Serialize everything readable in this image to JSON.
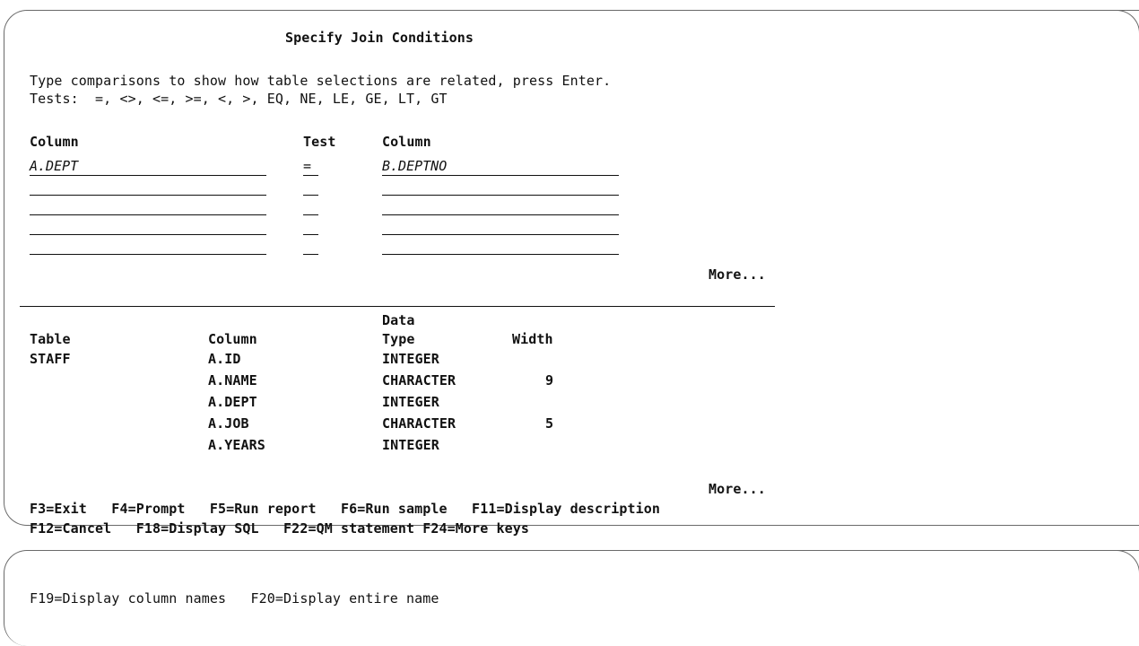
{
  "title": "Specify Join Conditions",
  "instructions": {
    "line1": "Type comparisons to show how table selections are related, press Enter.",
    "line2": "Tests:  =, <>, <=, >=, <, >, EQ, NE, LE, GE, LT, GT"
  },
  "join": {
    "headers": {
      "left_column": "Column",
      "test": "Test",
      "right_column": "Column"
    },
    "rows": [
      {
        "left": "A.DEPT",
        "test": "=",
        "right": "B.DEPTNO"
      },
      {
        "left": "",
        "test": "",
        "right": ""
      },
      {
        "left": "",
        "test": "",
        "right": ""
      },
      {
        "left": "",
        "test": "",
        "right": ""
      },
      {
        "left": "",
        "test": "",
        "right": ""
      }
    ],
    "more": "More..."
  },
  "columns_list": {
    "headers": {
      "table": "Table",
      "column": "Column",
      "data": "Data",
      "type": "Type",
      "width": "Width"
    },
    "rows": [
      {
        "table": "STAFF",
        "column": "A.ID",
        "type": "INTEGER",
        "width": ""
      },
      {
        "table": "",
        "column": "A.NAME",
        "type": "CHARACTER",
        "width": "9"
      },
      {
        "table": "",
        "column": "A.DEPT",
        "type": "INTEGER",
        "width": ""
      },
      {
        "table": "",
        "column": "A.JOB",
        "type": "CHARACTER",
        "width": "5"
      },
      {
        "table": "",
        "column": "A.YEARS",
        "type": "INTEGER",
        "width": ""
      }
    ],
    "more": "More..."
  },
  "function_keys": {
    "line1": "F3=Exit   F4=Prompt   F5=Run report   F6=Run sample   F11=Display description",
    "line2": "F12=Cancel   F18=Display SQL   F22=QM statement F24=More keys"
  },
  "extra_keys": "F19=Display column names   F20=Display entire name"
}
